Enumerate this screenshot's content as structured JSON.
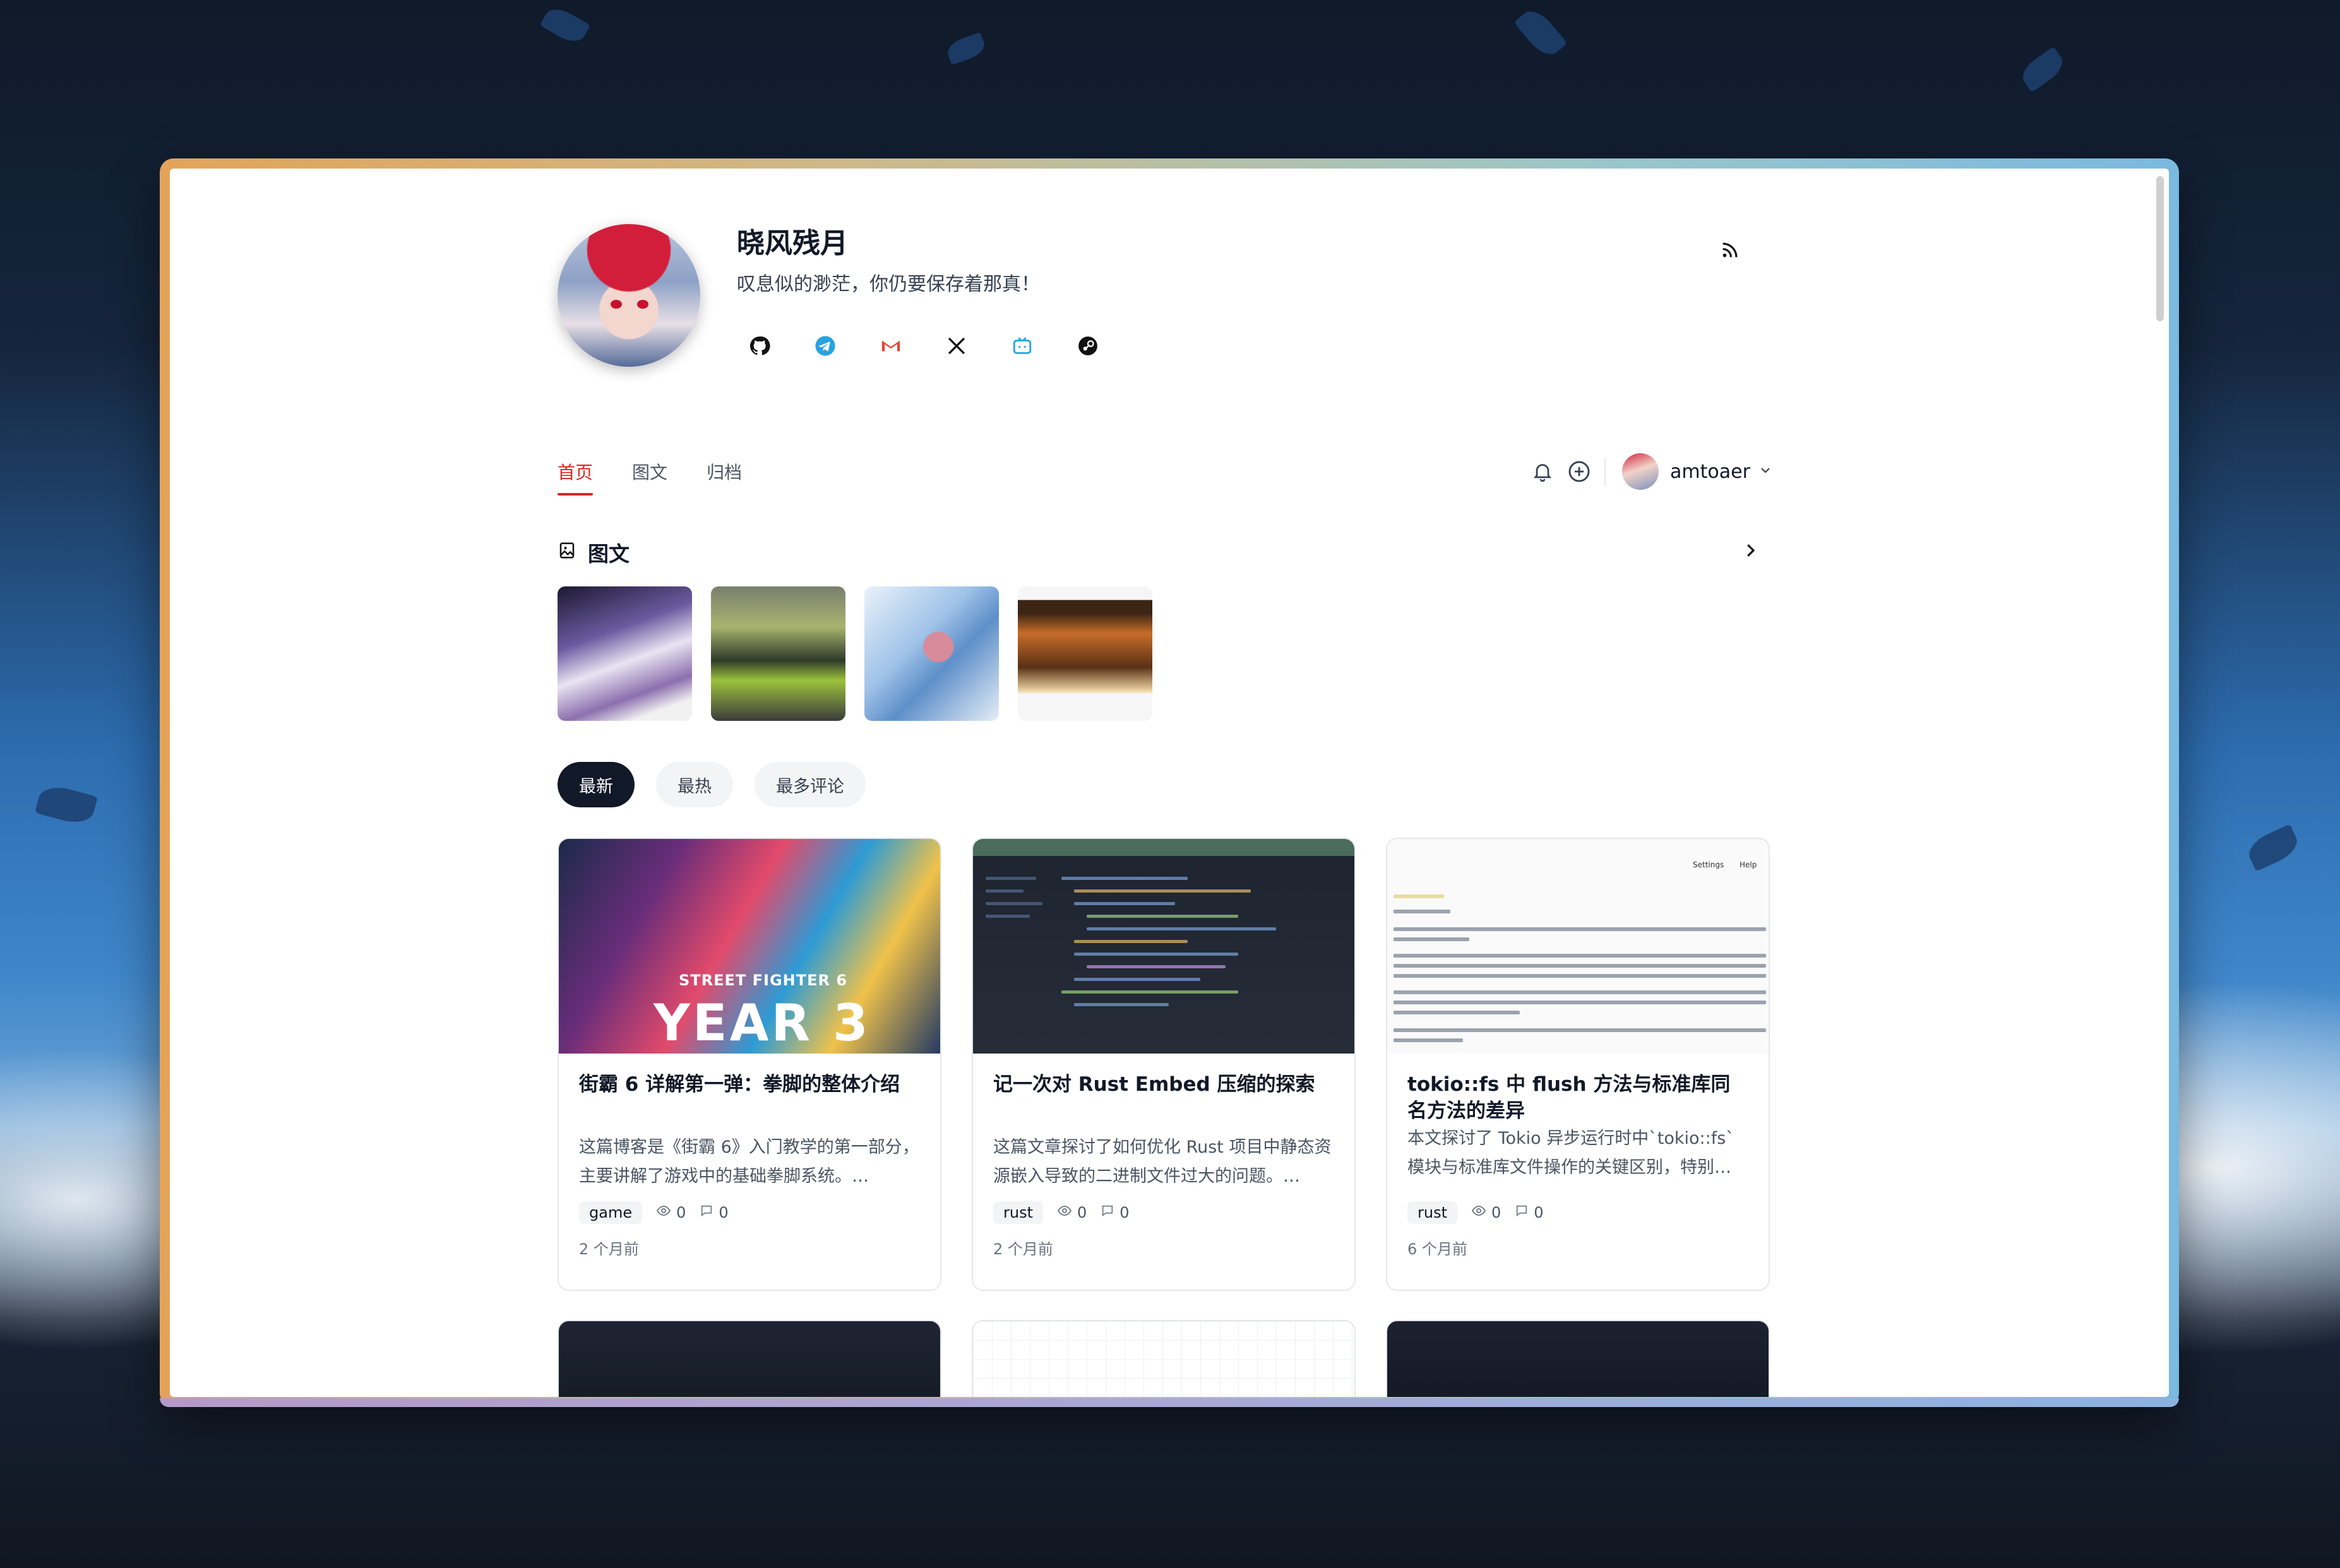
{
  "profile": {
    "name": "晓风残月",
    "bio": "叹息似的渺茫，你仍要保存着那真！",
    "socials": [
      "github-icon",
      "telegram-icon",
      "gmail-icon",
      "x-icon",
      "bilibili-icon",
      "steam-icon"
    ]
  },
  "nav": {
    "items": [
      {
        "label": "首页",
        "active": true
      },
      {
        "label": "图文",
        "active": false
      },
      {
        "label": "归档",
        "active": false
      }
    ],
    "username": "amtoaer"
  },
  "gallery": {
    "title": "图文",
    "thumbnails": [
      "cosplay-photo",
      "car-exhibition-photo",
      "anime-illustration",
      "game-screenshot"
    ]
  },
  "sort_tabs": [
    {
      "label": "最新",
      "active": true
    },
    {
      "label": "最热",
      "active": false
    },
    {
      "label": "最多评论",
      "active": false
    }
  ],
  "posts": [
    {
      "image_text_1": "STREET FIGHTER 6",
      "image_text_2": "YEAR 3",
      "title": "街霸 6 详解第一弹：拳脚的整体介绍",
      "excerpt": "这篇博客是《街霸 6》入门教学的第一部分，主要讲解了游戏中的基础拳脚系统。…",
      "tag": "game",
      "views": "0",
      "comments": "0",
      "time": "2 个月前"
    },
    {
      "title": "记一次对 Rust Embed 压缩的探索",
      "excerpt": "这篇文章探讨了如何优化 Rust 项目中静态资源嵌入导致的二进制文件过大的问题。…",
      "tag": "rust",
      "views": "0",
      "comments": "0",
      "time": "2 个月前"
    },
    {
      "image_header_1": "Settings",
      "image_header_2": "Help",
      "title": "tokio::fs 中 flush 方法与标准库同名方法的差异",
      "excerpt": "本文探讨了 Tokio 异步运行时中`tokio::fs`模块与标准库文件操作的关键区别，特别…",
      "tag": "rust",
      "views": "0",
      "comments": "0",
      "time": "6 个月前"
    }
  ],
  "colors": {
    "accent": "#dc2626",
    "dark_tab": "#111827",
    "frame_start": "#e3a459",
    "frame_end": "#7ab9e0"
  }
}
